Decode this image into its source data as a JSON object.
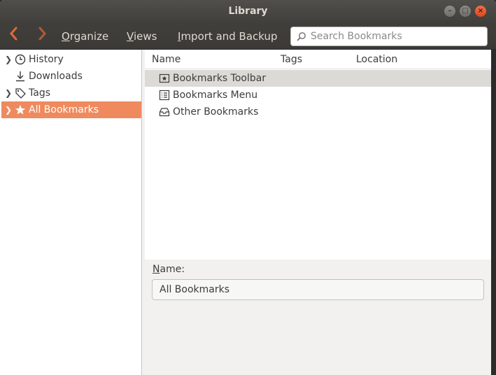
{
  "window": {
    "title": "Library"
  },
  "toolbar": {
    "organize_mnemonic": "O",
    "organize_rest": "rganize",
    "views_mnemonic": "V",
    "views_rest": "iews",
    "import_mnemonic": "I",
    "import_rest": "mport and Backup",
    "search_placeholder": "Search Bookmarks"
  },
  "sidebar": {
    "items": [
      {
        "label": "History",
        "expandable": true
      },
      {
        "label": "Downloads",
        "expandable": false
      },
      {
        "label": "Tags",
        "expandable": true
      },
      {
        "label": "All Bookmarks",
        "expandable": true,
        "selected": true
      }
    ]
  },
  "columns": [
    "Name",
    "Tags",
    "Location"
  ],
  "rows": [
    {
      "name": "Bookmarks Toolbar",
      "icon": "bookmarks-toolbar-icon",
      "selected": true
    },
    {
      "name": "Bookmarks Menu",
      "icon": "bookmarks-menu-icon",
      "selected": false
    },
    {
      "name": "Other Bookmarks",
      "icon": "other-bookmarks-icon",
      "selected": false
    }
  ],
  "details": {
    "name_mnemonic": "N",
    "name_rest": "ame:",
    "name_value": "All Bookmarks"
  },
  "colors": {
    "accent": "#ef8a5e",
    "titlebar": "#413f3b"
  }
}
